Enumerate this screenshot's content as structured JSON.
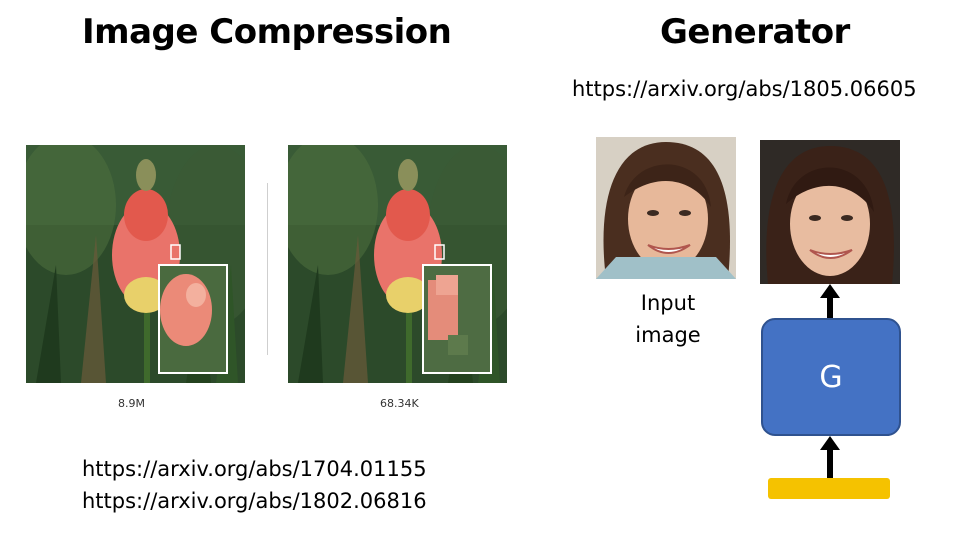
{
  "left": {
    "title": "Image Compression",
    "original_size": "8.9M",
    "compressed_size": "68.34K",
    "links": [
      "https://arxiv.org/abs/1704.01155",
      "https://arxiv.org/abs/1802.06816"
    ]
  },
  "right": {
    "title": "Generator",
    "link": "https://arxiv.org/abs/1805.06605",
    "input_label_line1": "Input",
    "input_label_line2": "image",
    "generator_label": "G"
  },
  "colors": {
    "generator_fill": "#4472c4",
    "noise_bar": "#f5c200"
  }
}
